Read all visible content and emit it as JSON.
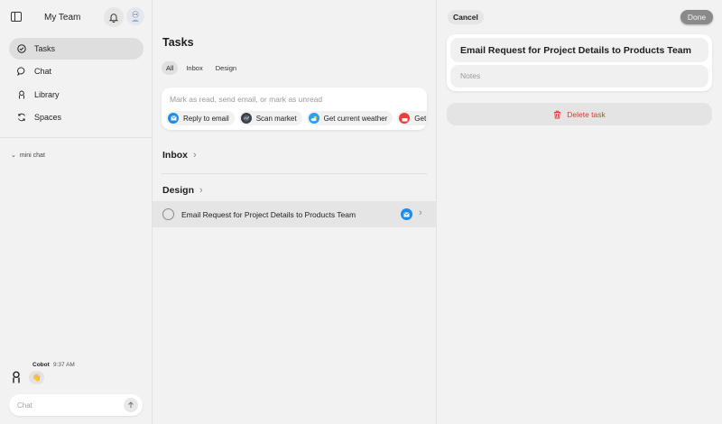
{
  "sidebar": {
    "team_name": "My Team",
    "nav": [
      {
        "label": "Tasks",
        "icon": "check-circle-icon",
        "active": true
      },
      {
        "label": "Chat",
        "icon": "chat-bubble-icon",
        "active": false
      },
      {
        "label": "Library",
        "icon": "library-icon",
        "active": false
      },
      {
        "label": "Spaces",
        "icon": "spaces-icon",
        "active": false
      }
    ],
    "mini_chat_label": "mini chat",
    "message": {
      "sender": "Cobot",
      "time": "9:37 AM",
      "content": "👋"
    },
    "chat_placeholder": "Chat"
  },
  "middle": {
    "title": "Tasks",
    "filters": [
      {
        "label": "All",
        "active": true
      },
      {
        "label": "Inbox",
        "active": false
      },
      {
        "label": "Design",
        "active": false
      }
    ],
    "composer": {
      "placeholder": "Mark as read, send email, or mark as unread",
      "suggestions": [
        {
          "label": "Reply to email",
          "icon": "mail-icon"
        },
        {
          "label": "Scan market",
          "icon": "market-icon"
        },
        {
          "label": "Get current weather",
          "icon": "weather-icon"
        },
        {
          "label": "Get e",
          "icon": "calendar-icon"
        }
      ]
    },
    "sections": [
      {
        "label": "Inbox"
      },
      {
        "label": "Design"
      }
    ],
    "task": {
      "title": "Email Request for Project Details to Products Team"
    }
  },
  "detail": {
    "cancel_label": "Cancel",
    "done_label": "Done",
    "title": "Email Request for Project Details to Products Team",
    "notes_placeholder": "Notes",
    "delete_label": "Delete task"
  },
  "colors": {
    "accent_blue": "#1a8cf0",
    "delete_red": "#e03a2f"
  }
}
